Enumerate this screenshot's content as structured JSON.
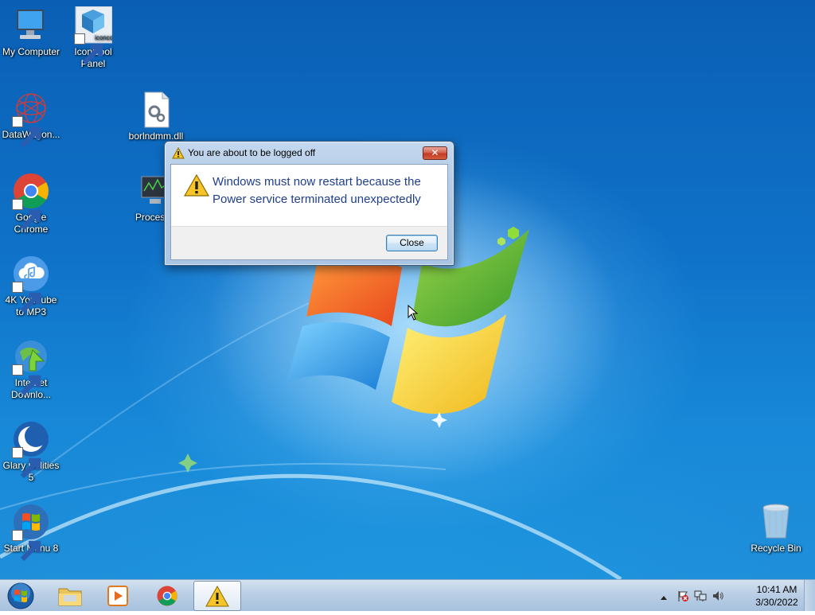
{
  "desktop": {
    "icons": [
      {
        "label": "My Computer",
        "icon": "computer-icon"
      },
      {
        "label": "IconCool Panel",
        "icon": "iconcool-icon",
        "badge": "iconcool"
      },
      {
        "label": "DataWagon...",
        "icon": "datawagon-icon"
      },
      {
        "label": "borlndmm.dll",
        "icon": "dll-file-icon"
      },
      {
        "label": "ProcessH",
        "icon": "process-monitor-icon"
      },
      {
        "label": "Google Chrome",
        "icon": "chrome-icon"
      },
      {
        "label": "4K YouTube to MP3",
        "icon": "music-cloud-icon"
      },
      {
        "label": "Internet Downlo...",
        "icon": "internet-download-manager-icon"
      },
      {
        "label": "Glary Utilities 5",
        "icon": "glary-utilities-icon"
      },
      {
        "label": "Start Menu 8",
        "icon": "windows-logo-icon"
      },
      {
        "label": "Recycle Bin",
        "icon": "recycle-bin-icon"
      }
    ]
  },
  "dialog": {
    "title": "You are about to be logged off",
    "message": "Windows must now restart because the Power service terminated unexpectedly",
    "close_button": "Close",
    "close_x": "✕",
    "icon": "warning-icon"
  },
  "taskbar": {
    "items": [
      {
        "name": "start-button",
        "icon": "windows-orb-icon"
      },
      {
        "name": "explorer",
        "icon": "folder-icon"
      },
      {
        "name": "media-player",
        "icon": "media-player-icon"
      },
      {
        "name": "chrome",
        "icon": "chrome-icon"
      },
      {
        "name": "warning-dialog",
        "icon": "warning-icon",
        "active": true
      }
    ],
    "tray": {
      "icons": [
        "show-hidden-icons-arrow",
        "action-center-flag-icon",
        "network-icon",
        "volume-icon"
      ],
      "time": "10:41 AM",
      "date": "3/30/2022"
    }
  },
  "colors": {
    "wallpaper_blue": "#0f73c9",
    "dialog_text": "#1f3e8c",
    "close_x_red": "#c23b22"
  }
}
